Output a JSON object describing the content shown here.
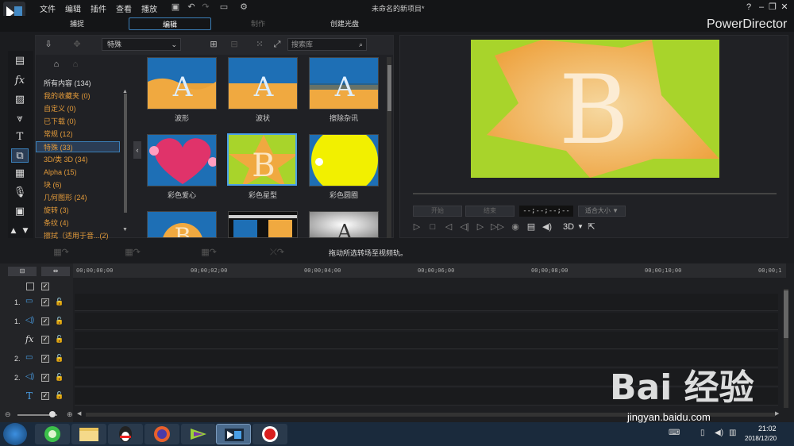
{
  "menu": [
    "文件",
    "编辑",
    "插件",
    "查看",
    "播放"
  ],
  "doc_title": "未命名的新项目*",
  "brand": "PowerDirector",
  "modes": {
    "capture": "捕捉",
    "edit": "编辑",
    "produce": "制作",
    "disc": "创建光盘"
  },
  "library": {
    "category_select": "特殊",
    "search_placeholder": "搜索库",
    "categories": [
      "所有内容 (134)",
      "我的收藏夹 (0)",
      "自定义 (0)",
      "已下载 (0)",
      "常规 (12)",
      "特殊 (33)",
      "3D/类 3D (34)",
      "Alpha (15)",
      "块 (6)",
      "几何图形 (24)",
      "旋转 (3)",
      "条纹 (4)",
      "擦拭（适用于音...(2)"
    ],
    "thumbs": [
      "波形",
      "波状",
      "擦除杂讯",
      "彩色爱心",
      "彩色星型",
      "彩色圆圈",
      "",
      "",
      ""
    ]
  },
  "preview": {
    "letter": "B",
    "btn_start": "开始",
    "btn_end": "结束",
    "timecode": "--;--;--;--",
    "fit": "适合大小 ▼",
    "mode3d": "3D"
  },
  "hint": "拖动所选转场至视频轨。",
  "ruler_ticks": [
    "00;00;00;00",
    "00;00;02;00",
    "00;00;04;00",
    "00;00;06;00",
    "00;00;08;00",
    "00;00;10;00",
    "00;00;1"
  ],
  "tracks": [
    "1.",
    "1.",
    "",
    "2.",
    "2.",
    ""
  ],
  "clock": {
    "time": "21:02",
    "date": "2018/12/20"
  },
  "watermark": {
    "main": "Bai 经验",
    "url": "jingyan.baidu.com"
  },
  "colors": {
    "accent": "#3b7fb8",
    "category": "#e29a3a",
    "preview_bg": "#a8d42b"
  }
}
